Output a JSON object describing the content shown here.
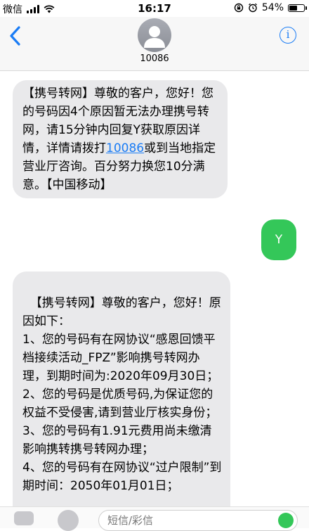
{
  "status_bar": {
    "carrier": "微信",
    "time": "16:17",
    "battery": "54%",
    "icons": [
      "signal-icon",
      "wifi-icon",
      "rotation-lock-icon",
      "alarm-icon",
      "battery-icon"
    ]
  },
  "header": {
    "contact_name": "10086",
    "info_label": "i",
    "icons": [
      "back-chevron-icon",
      "contact-avatar-icon",
      "info-icon"
    ]
  },
  "messages": [
    {
      "direction": "incoming",
      "text_before_link": "【携号转网】尊敬的客户，您好！您的号码因4个原因暂无法办理携号转网，请15分钟内回复Y获取原因详情，详情请拨打",
      "link": "10086",
      "text_after_link": "或到当地指定营业厅咨询。百分努力换您10分满意。【中国移动】"
    },
    {
      "direction": "outgoing",
      "text": "Y"
    },
    {
      "direction": "incoming",
      "text": "【携号转网】尊敬的客户，您好！原因如下：\n1、您的号码有在网协议“感恩回馈平档接续活动_FPZ”影响携号转网办理，到期时间为:2020年09月30日；\n2、您的号码是优质号码,为保证您的权益不受侵害,请到营业厅核实身份；\n3、您的号码有1.91元费用尚未缴清影响携转携号转网办理；\n4、您的号码有在网协议“过户限制”到期时间：2050年01月01日；"
    }
  ],
  "input_bar": {
    "placeholder": "短信/彩信",
    "icons": [
      "camera-icon",
      "appstore-icon",
      "send-arrow-icon"
    ]
  },
  "colors": {
    "incoming_bubble": "#e9e9eb",
    "outgoing_bubble": "#34c759",
    "link": "#1a7cf5",
    "header_bg": "#f7f7f7"
  }
}
